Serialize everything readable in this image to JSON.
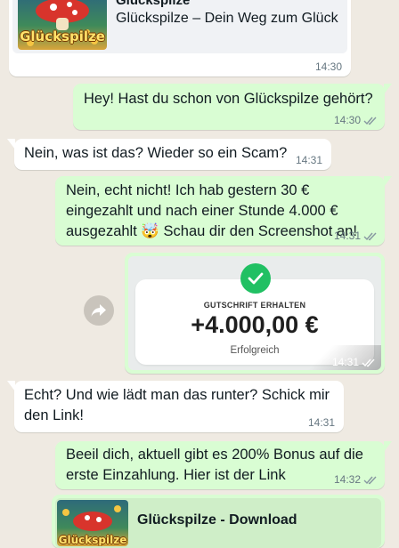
{
  "colors": {
    "chat_bg": "#efeae2",
    "incoming_bubble": "#ffffff",
    "outgoing_bubble": "#d9fdd3",
    "check_green": "#21c063",
    "read_ticks": "#8696a0"
  },
  "messages": [
    {
      "id": "m1",
      "direction": "incoming",
      "type": "link_preview",
      "preview_site": "Glückspilze",
      "preview_title": "Glückspilze – Dein Weg zum Glück",
      "thumb_logo_text": "Glückspilze",
      "time": "14:30"
    },
    {
      "id": "m2",
      "direction": "outgoing",
      "type": "text",
      "text": "Hey! Hast du schon von Glückspilze gehört?",
      "time": "14:30",
      "status_icon": "double-check-icon"
    },
    {
      "id": "m3",
      "direction": "incoming",
      "type": "text",
      "text": "Nein, was ist das? Wieder so ein Scam?",
      "time": "14:31"
    },
    {
      "id": "m4",
      "direction": "outgoing",
      "type": "text",
      "text": "Nein, echt nicht! Ich hab gestern 30 € eingezahlt und nach einer Stunde 4.000 € ausgezahlt 🤯 Schau dir den Screenshot an!",
      "time": "14:31",
      "status_icon": "double-check-icon"
    },
    {
      "id": "m5",
      "direction": "outgoing",
      "type": "image",
      "card_label": "GUTSCHRIFT ERHALTEN",
      "card_amount": "+4.000,00 €",
      "card_status": "Erfolgreich",
      "card_icon": "check-circle-icon",
      "forward_icon": "forward-icon",
      "time": "14:31",
      "status_icon": "double-check-icon"
    },
    {
      "id": "m6",
      "direction": "incoming",
      "type": "text",
      "text": "Echt? Und wie lädt man das runter? Schick mir den Link!",
      "time": "14:31"
    },
    {
      "id": "m7",
      "direction": "outgoing",
      "type": "text",
      "text": "Beeil dich, aktuell gibt es 200% Bonus auf die erste Einzahlung. Hier ist der Link",
      "time": "14:32",
      "status_icon": "double-check-icon"
    },
    {
      "id": "m8",
      "direction": "outgoing",
      "type": "link_preview",
      "preview_title": "Glückspilze - Download",
      "thumb_logo_text": "Glückspilze"
    }
  ]
}
